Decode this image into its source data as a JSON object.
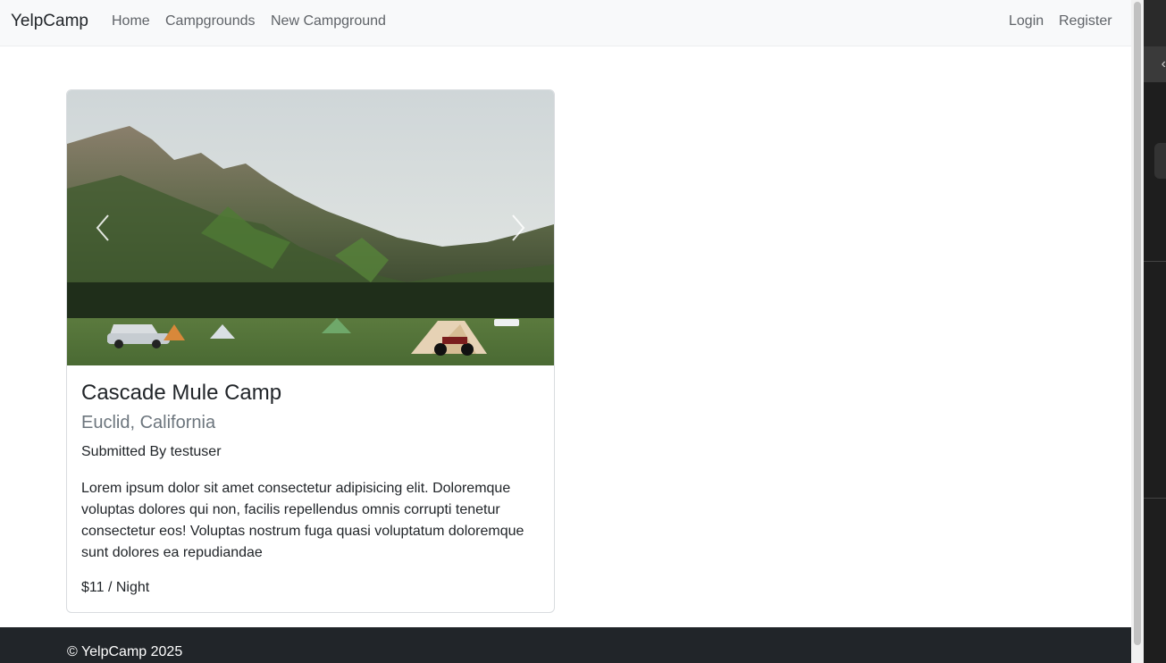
{
  "navbar": {
    "brand": "YelpCamp",
    "links": [
      "Home",
      "Campgrounds",
      "New Campground"
    ],
    "auth_links": [
      "Login",
      "Register"
    ]
  },
  "campground": {
    "title": "Cascade Mule Camp",
    "location": "Euclid, California",
    "submitted_by": "Submitted By testuser",
    "description": "Lorem ipsum dolor sit amet consectetur adipisicing elit. Doloremque voluptas dolores qui non, facilis repellendus omnis corrupti tenetur consectetur eos! Voluptas nostrum fuga quasi voluptatum doloremque sunt dolores ea repudiandae",
    "price": "$11 / Night"
  },
  "carousel": {
    "image": "campground-mountain-photo",
    "prev_icon": "chevron-left-icon",
    "next_icon": "chevron-right-icon"
  },
  "footer": {
    "text": "© YelpCamp 2025"
  },
  "colors": {
    "navbar_bg": "#f8f9fa",
    "footer_bg": "#212529",
    "subtitle": "#6c757d",
    "link": "#5f6368"
  }
}
